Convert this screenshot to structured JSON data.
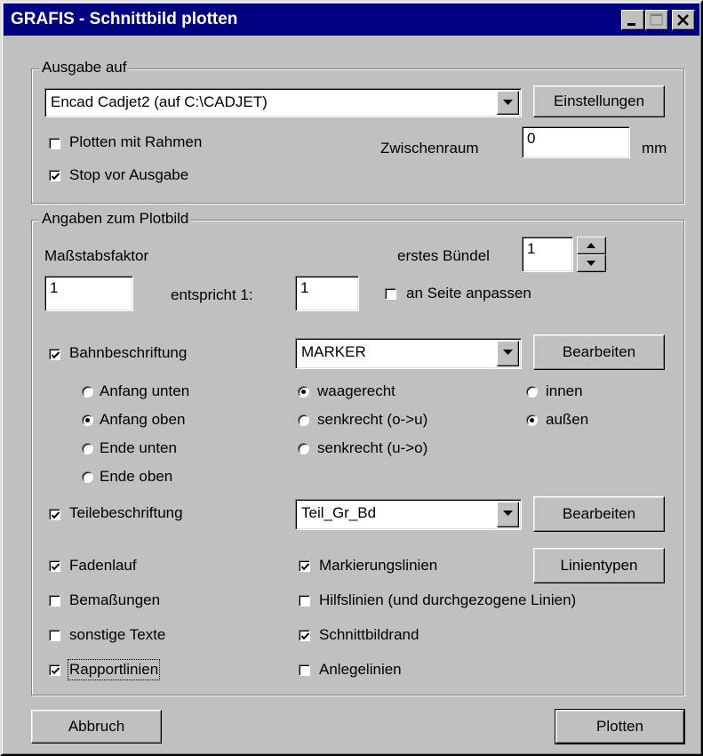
{
  "window": {
    "title": "GRAFIS - Schnittbild plotten"
  },
  "titlebar_buttons": {
    "minimize": "minimize-icon",
    "maximize": "maximize-icon",
    "close": "close-icon"
  },
  "ausgabe": {
    "legend": "Ausgabe auf",
    "device_value": "Encad Cadjet2 (auf C:\\CADJET)",
    "settings_label": "Einstellungen",
    "plot_frame_label": "Plotten mit Rahmen",
    "plot_frame_checked": false,
    "stop_label": "Stop vor Ausgabe",
    "stop_checked": true,
    "spacing_label": "Zwischenraum",
    "spacing_value": "0",
    "spacing_unit": "mm"
  },
  "plotbild": {
    "legend": "Angaben zum Plotbild",
    "scale_label": "Maßstabsfaktor",
    "scale_value": "1",
    "equals_label": "entspricht 1:",
    "equals_value": "1",
    "first_bundle_label": "erstes Bündel",
    "first_bundle_value": "1",
    "fit_page_label": "an Seite anpassen",
    "fit_page_checked": false,
    "bahn_label": "Bahnbeschriftung",
    "bahn_checked": true,
    "bahn_select": "MARKER",
    "bahn_edit": "Bearbeiten",
    "pos_options": [
      "Anfang unten",
      "Anfang oben",
      "Ende unten",
      "Ende oben"
    ],
    "pos_selected": 1,
    "dir_options": [
      "waagerecht",
      "senkrecht (o->u)",
      "senkrecht (u->o)"
    ],
    "dir_selected": 0,
    "side_options": [
      "innen",
      "außen"
    ],
    "side_selected": 1,
    "teile_label": "Teilebeschriftung",
    "teile_checked": true,
    "teile_select": "Teil_Gr_Bd",
    "teile_edit": "Bearbeiten",
    "fadenlauf_label": "Fadenlauf",
    "fadenlauf_checked": true,
    "markierung_label": "Markierungslinien",
    "markierung_checked": true,
    "linientypen_label": "Linientypen",
    "bemassungen_label": "Bemaßungen",
    "bemassungen_checked": false,
    "hilfslinien_label": "Hilfslinien (und durchgezogene Linien)",
    "hilfslinien_checked": false,
    "sonstige_label": "sonstige Texte",
    "sonstige_checked": false,
    "schnittbildrand_label": "Schnittbildrand",
    "schnittbildrand_checked": true,
    "rapport_label": "Rapportlinien",
    "rapport_checked": true,
    "anlege_label": "Anlegelinien",
    "anlege_checked": false
  },
  "footer": {
    "cancel_label": "Abbruch",
    "plot_label": "Plotten"
  }
}
